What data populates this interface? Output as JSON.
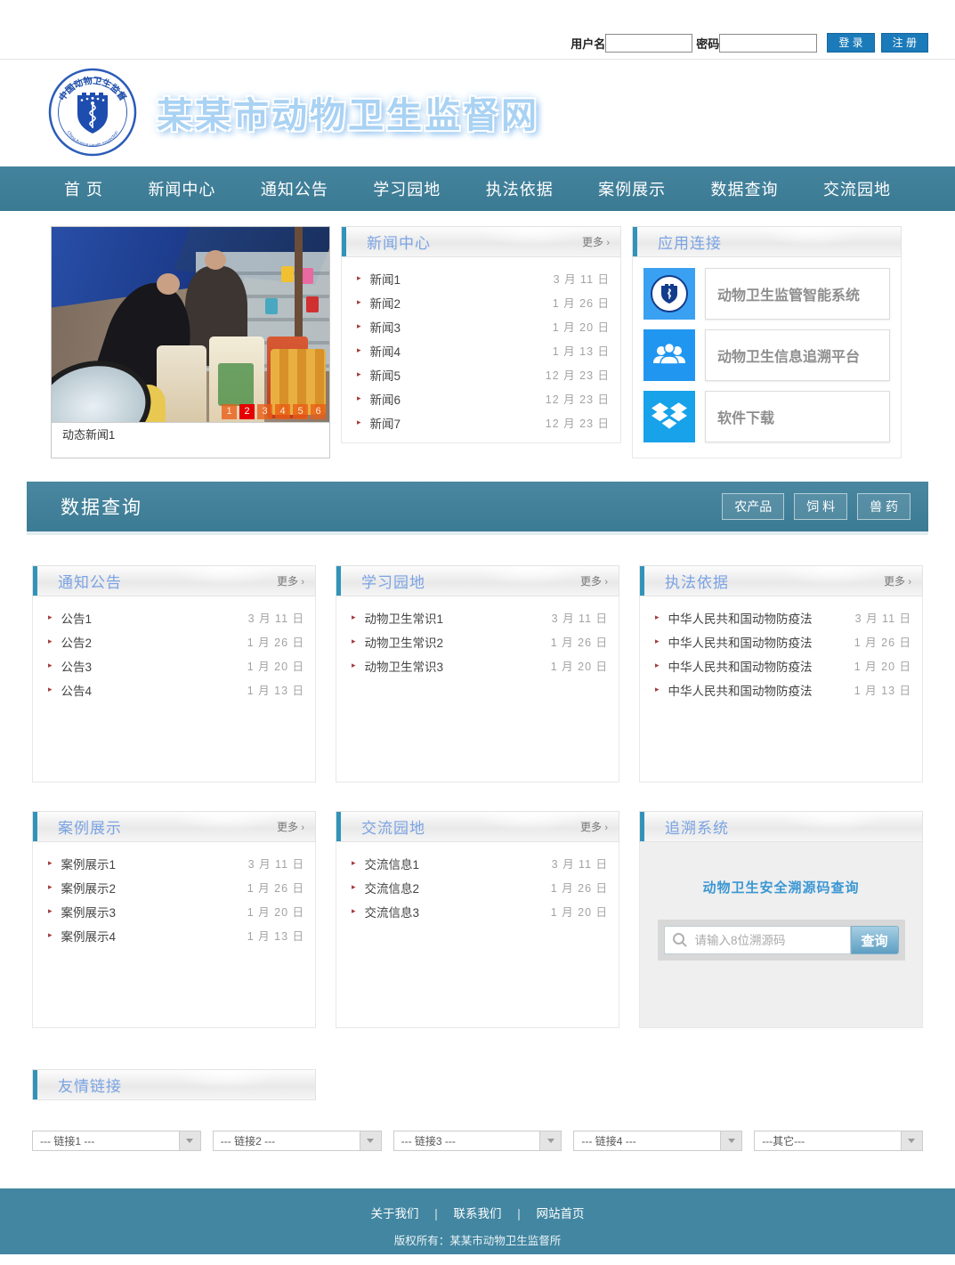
{
  "topbar": {
    "username_label": "用户名",
    "password_label": "密码",
    "login_button": "登 录",
    "register_button": "注 册"
  },
  "header": {
    "site_title": "某某市动物卫生监督网",
    "logo_arc_top": "中国动物卫生监督",
    "logo_arc_bottom": "China Animal Health Inspection"
  },
  "nav": {
    "items": [
      "首 页",
      "新闻中心",
      "通知公告",
      "学习园地",
      "执法依据",
      "案例展示",
      "数据查询",
      "交流园地"
    ]
  },
  "carousel": {
    "caption": "动态新闻1",
    "pages": [
      "1",
      "2",
      "3",
      "4",
      "5",
      "6"
    ],
    "active_page": "2"
  },
  "news_center": {
    "title": "新闻中心",
    "more_label": "更多",
    "more_arrow": "›",
    "items": [
      {
        "text": "新闻1",
        "date": "3 月 11 日"
      },
      {
        "text": "新闻2",
        "date": "1 月 26 日"
      },
      {
        "text": "新闻3",
        "date": "1 月 20 日"
      },
      {
        "text": "新闻4",
        "date": "1 月 13 日"
      },
      {
        "text": "新闻5",
        "date": "12 月 23 日"
      },
      {
        "text": "新闻6",
        "date": "12 月 23 日"
      },
      {
        "text": "新闻7",
        "date": "12 月 23 日"
      }
    ]
  },
  "app_links": {
    "title": "应用连接",
    "items": [
      {
        "icon": "shield-badge-icon",
        "label": "动物卫生监管智能系统"
      },
      {
        "icon": "people-icon",
        "label": "动物卫生信息追溯平台"
      },
      {
        "icon": "download-box-icon",
        "label": "软件下载"
      }
    ]
  },
  "data_query_bar": {
    "title": "数据查询",
    "buttons": [
      "农产品",
      "饲 料",
      "兽 药"
    ]
  },
  "notices": {
    "title": "通知公告",
    "more_label": "更多",
    "more_arrow": "›",
    "items": [
      {
        "text": "公告1",
        "date": "3 月 11 日"
      },
      {
        "text": "公告2",
        "date": "1 月 26 日"
      },
      {
        "text": "公告3",
        "date": "1 月 20 日"
      },
      {
        "text": "公告4",
        "date": "1 月 13 日"
      }
    ]
  },
  "study": {
    "title": "学习园地",
    "more_label": "更多",
    "more_arrow": "›",
    "items": [
      {
        "text": "动物卫生常识1",
        "date": "3 月 11 日"
      },
      {
        "text": "动物卫生常识2",
        "date": "1 月 26 日"
      },
      {
        "text": "动物卫生常识3",
        "date": "1 月 20 日"
      }
    ]
  },
  "law": {
    "title": "执法依据",
    "more_label": "更多",
    "more_arrow": "›",
    "items": [
      {
        "text": "中华人民共和国动物防疫法",
        "date": "3 月 11 日"
      },
      {
        "text": "中华人民共和国动物防疫法",
        "date": "1 月 26 日"
      },
      {
        "text": "中华人民共和国动物防疫法",
        "date": "1 月 20 日"
      },
      {
        "text": "中华人民共和国动物防疫法",
        "date": "1 月 13 日"
      }
    ]
  },
  "cases": {
    "title": "案例展示",
    "more_label": "更多",
    "more_arrow": "›",
    "items": [
      {
        "text": "案例展示1",
        "date": "3 月 11 日"
      },
      {
        "text": "案例展示2",
        "date": "1 月 26 日"
      },
      {
        "text": "案例展示3",
        "date": "1 月 20 日"
      },
      {
        "text": "案例展示4",
        "date": "1 月 13 日"
      }
    ]
  },
  "exchange": {
    "title": "交流园地",
    "more_label": "更多",
    "more_arrow": "›",
    "items": [
      {
        "text": "交流信息1",
        "date": "3 月 11 日"
      },
      {
        "text": "交流信息2",
        "date": "1 月 26 日"
      },
      {
        "text": "交流信息3",
        "date": "1 月 20 日"
      }
    ]
  },
  "trace": {
    "title": "追溯系统",
    "heading": "动物卫生安全溯源码查询",
    "placeholder": "请输入8位溯源码",
    "search_button": "查询"
  },
  "friend_links": {
    "title": "友情链接",
    "selects": [
      "--- 链接1 ---",
      "--- 链接2 ---",
      "--- 链接3 ---",
      "--- 链接4 ---",
      "---其它---"
    ]
  },
  "footer": {
    "links": [
      "关于我们",
      "联系我们",
      "网站首页"
    ],
    "separator": "|",
    "copyright": "版权所有：某某市动物卫生监督所"
  },
  "colors": {
    "nav_teal": "#3e7d97",
    "footer_teal": "#4286a1",
    "panel_title_blue": "#7ba3e3",
    "accent_bar": "#3193ba",
    "login_button_blue": "#1b7ab9",
    "active_page_red": "#e60000"
  }
}
